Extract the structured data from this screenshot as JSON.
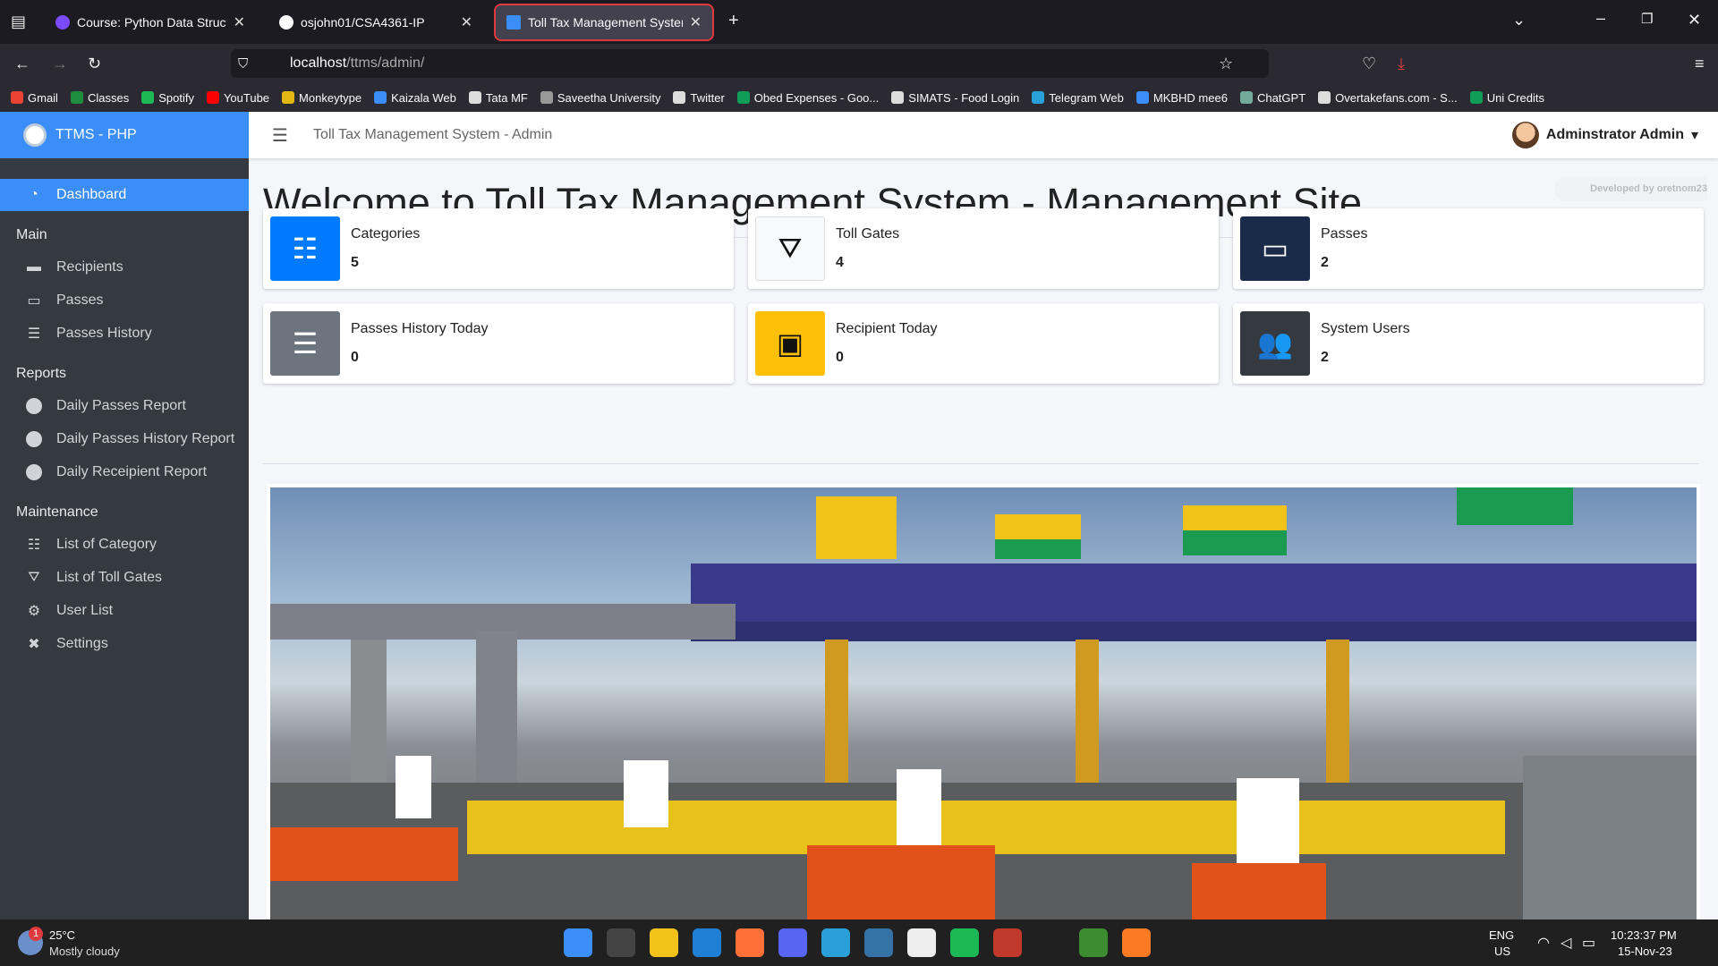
{
  "browser": {
    "tabs": [
      {
        "label": "Course: Python Data Structures",
        "color": "#7b4cff"
      },
      {
        "label": "osjohn01/CSA4361-IP",
        "color": "#ffffff"
      },
      {
        "label": "Toll Tax Management System",
        "color": "#3b8df7"
      }
    ],
    "url_host": "localhost",
    "url_path": "/ttms/admin/"
  },
  "bookmarks": [
    {
      "label": "Gmail",
      "color": "#ea4335"
    },
    {
      "label": "Classes",
      "color": "#1e8e3e"
    },
    {
      "label": "Spotify",
      "color": "#1db954"
    },
    {
      "label": "YouTube",
      "color": "#ff0000"
    },
    {
      "label": "Monkeytype",
      "color": "#e2b714"
    },
    {
      "label": "Kaizala Web",
      "color": "#3b8df7"
    },
    {
      "label": "Tata MF",
      "color": "#ddd"
    },
    {
      "label": "Saveetha University",
      "color": "#999"
    },
    {
      "label": "Twitter",
      "color": "#ddd"
    },
    {
      "label": "Obed Expenses - Goo...",
      "color": "#0f9d58"
    },
    {
      "label": "SIMATS - Food Login",
      "color": "#ddd"
    },
    {
      "label": "Telegram Web",
      "color": "#2aa1da"
    },
    {
      "label": "MKBHD mee6",
      "color": "#3b8df7"
    },
    {
      "label": "ChatGPT",
      "color": "#74aa9c"
    },
    {
      "label": "Overtakefans.com - S...",
      "color": "#ddd"
    },
    {
      "label": "Uni Credits",
      "color": "#0f9d58"
    }
  ],
  "sidebar": {
    "brand": "TTMS - PHP",
    "active": "Dashboard",
    "sections": [
      {
        "title": "Main",
        "items": [
          {
            "label": "Recipients",
            "icon": "receipt-icon"
          },
          {
            "label": "Passes",
            "icon": "ticket-icon"
          },
          {
            "label": "Passes History",
            "icon": "list-icon"
          }
        ]
      },
      {
        "title": "Reports",
        "items": [
          {
            "label": "Daily Passes Report",
            "icon": "circle-icon"
          },
          {
            "label": "Daily Passes History Report",
            "icon": "circle-icon"
          },
          {
            "label": "Daily Receipient Report",
            "icon": "circle-icon"
          }
        ]
      },
      {
        "title": "Maintenance",
        "items": [
          {
            "label": "List of Category",
            "icon": "th-list-icon"
          },
          {
            "label": "List of Toll Gates",
            "icon": "road-icon"
          },
          {
            "label": "User List",
            "icon": "users-cog-icon"
          },
          {
            "label": "Settings",
            "icon": "tools-icon"
          }
        ]
      }
    ]
  },
  "header": {
    "title": "Toll Tax Management System - Admin",
    "user": "Adminstrator Admin",
    "developed": "Developed by oretnom23"
  },
  "page": {
    "welcome": "Welcome to Toll Tax Management System - Management Site"
  },
  "cards": [
    {
      "label": "Categories",
      "value": "5",
      "color": "#007bff",
      "icon": "th-list-icon"
    },
    {
      "label": "Toll Gates",
      "value": "4",
      "color": "#f8f9fa",
      "icon": "road-icon"
    },
    {
      "label": "Passes",
      "value": "2",
      "color": "#1a2b4a",
      "icon": "credit-card-icon"
    },
    {
      "label": "Passes History Today",
      "value": "0",
      "color": "#6c757d",
      "icon": "stream-icon"
    },
    {
      "label": "Recipient Today",
      "value": "0",
      "color": "#ffc107",
      "icon": "receipt-icon"
    },
    {
      "label": "System Users",
      "value": "2",
      "color": "#343a40",
      "icon": "users-icon"
    }
  ],
  "taskbar": {
    "weather_temp": "25°C",
    "weather_desc": "Mostly cloudy",
    "lang1": "ENG",
    "lang2": "US",
    "time": "10:23:37 PM",
    "date": "15-Nov-23",
    "notif": "1"
  }
}
